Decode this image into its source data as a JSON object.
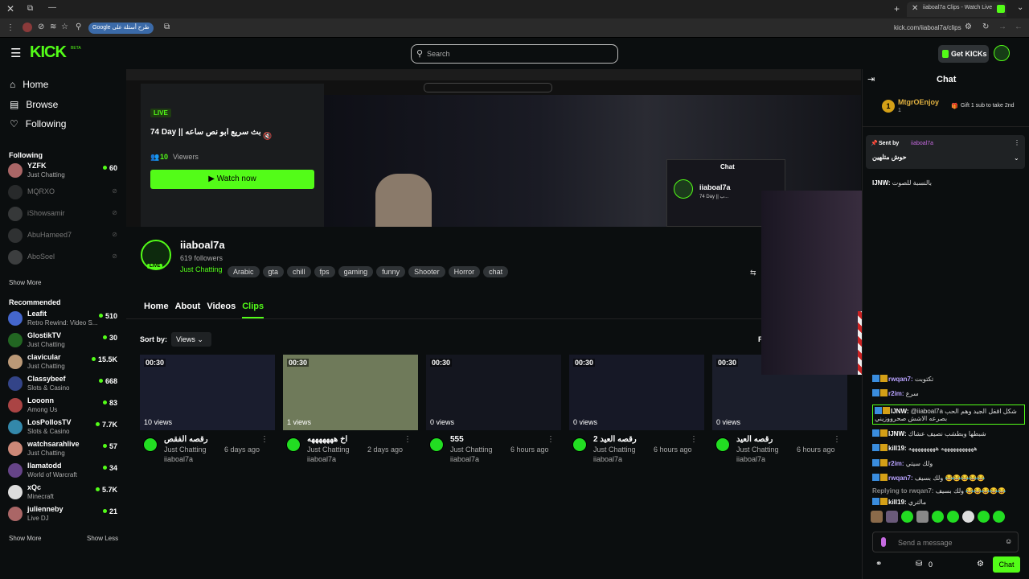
{
  "browser": {
    "tab_title": "iiaboal7a Clips - Watch Live",
    "url": "kick.com/iiaboal7a/clips",
    "search_pill": "Google طرح أسئلة على"
  },
  "header": {
    "logo": "KICK",
    "logo_beta": "BETA",
    "search_placeholder": "Search",
    "get_kicks": "Get KICKs"
  },
  "sidebar": {
    "nav": [
      {
        "label": "Home",
        "icon": "home-icon"
      },
      {
        "label": "Browse",
        "icon": "browse-icon"
      },
      {
        "label": "Following",
        "icon": "heart-icon"
      }
    ],
    "following_title": "Following",
    "following": [
      {
        "name": "YZFK",
        "sub": "Just Chatting",
        "count": "60",
        "live": true,
        "color": "#a66"
      },
      {
        "name": "MQRXO",
        "sub": "",
        "count": "",
        "live": false,
        "color": "#555"
      },
      {
        "name": "iShowsamir",
        "sub": "",
        "count": "",
        "live": false,
        "color": "#777"
      },
      {
        "name": "AbuHameed7",
        "sub": "",
        "count": "",
        "live": false,
        "color": "#666"
      },
      {
        "name": "AboSoel",
        "sub": "",
        "count": "",
        "live": false,
        "color": "#888"
      }
    ],
    "show_more_1": "Show More",
    "recommended_title": "Recommended",
    "recommended": [
      {
        "name": "Leafit",
        "sub": "Retro Rewind: Video S...",
        "count": "510",
        "color": "#46c"
      },
      {
        "name": "GlostikTV",
        "sub": "Just Chatting",
        "count": "30",
        "color": "#262"
      },
      {
        "name": "clavicular",
        "sub": "Just Chatting",
        "count": "15.5K",
        "color": "#b97"
      },
      {
        "name": "Classybeef",
        "sub": "Slots & Casino",
        "count": "668",
        "color": "#348"
      },
      {
        "name": "Looonn",
        "sub": "Among Us",
        "count": "83",
        "color": "#a44"
      },
      {
        "name": "LosPollosTV",
        "sub": "Slots & Casino",
        "count": "7.7K",
        "color": "#38a"
      },
      {
        "name": "watchsarahlive",
        "sub": "Just Chatting",
        "count": "57",
        "color": "#c87"
      },
      {
        "name": "llamatodd",
        "sub": "World of Warcraft",
        "count": "34",
        "color": "#648"
      },
      {
        "name": "xQc",
        "sub": "Minecraft",
        "count": "5.7K",
        "color": "#ddd"
      },
      {
        "name": "julienneby",
        "sub": "Live DJ",
        "count": "21",
        "color": "#a66"
      }
    ],
    "show_more_2": "Show More",
    "show_less": "Show Less"
  },
  "player": {
    "live_badge": "LIVE",
    "stream_title": "74 Day || بث سريع ابو نص ساعه",
    "viewers_count": "10",
    "viewers_label": "Viewers",
    "watch_now": "Watch now",
    "inner_chat": "Chat",
    "inner_channel": "iiaboal7a",
    "inner_title": "74 Day || ب..."
  },
  "channel": {
    "name": "iiaboal7a",
    "followers": "619 followers",
    "category": "Just Chatting",
    "tags": [
      "Arabic",
      "gta",
      "chill",
      "fps",
      "gaming",
      "funny",
      "Shooter",
      "Horror",
      "chat"
    ],
    "live_badge": "LIVE"
  },
  "tabs": [
    "Home",
    "About",
    "Videos",
    "Clips"
  ],
  "active_tab": "Clips",
  "sort": {
    "label": "Sort by:",
    "value": "Views"
  },
  "clips": [
    {
      "duration": "00:30",
      "views": "10 views",
      "title": "رقصه الفقص",
      "category": "Just Chatting",
      "age": "6 days ago",
      "author": "iiaboal7a",
      "bg": "#1a1d2e"
    },
    {
      "duration": "00:30",
      "views": "1 views",
      "title": "اخ هههههههه",
      "category": "Just Chatting",
      "age": "2 days ago",
      "author": "iiaboal7a",
      "bg": "#6f7a5a"
    },
    {
      "duration": "00:30",
      "views": "0 views",
      "title": "555",
      "category": "Just Chatting",
      "age": "6 hours ago",
      "author": "iiaboal7a",
      "bg": "#14161f"
    },
    {
      "duration": "00:30",
      "views": "0 views",
      "title": "رقصه العيد 2",
      "category": "Just Chatting",
      "age": "6 hours ago",
      "author": "iiaboal7a",
      "bg": "#161826"
    },
    {
      "duration": "00:30",
      "views": "0 views",
      "title": "رقصه العيد",
      "category": "Just Chatting",
      "age": "6 hours ago",
      "author": "iiaboal7a",
      "bg": "#1b1e2b"
    }
  ],
  "chat": {
    "title": "Chat",
    "top_gifter": "MtgrOEnjoy",
    "top_gifter_count": "1",
    "gift_text": "Gift 1 sub to take 2nd",
    "pinned_sent_by": "Sent by",
    "pinned_user": "iiaboal7a",
    "pinned_text": "حوش متلهين",
    "messages": [
      {
        "user": "IJNW:",
        "text": "بالنسبة للصوت",
        "color": "#fff"
      },
      {
        "user": "rwqan7:",
        "text": "تكتوبت",
        "color": "#b9a3ff"
      },
      {
        "user": "r2im:",
        "text": "سرع",
        "color": "#b9a3ff"
      },
      {
        "user": "IJNW:",
        "text": "@iiaboal7a شكل اقفل الجيد وهم الحب بصرعه الاشش صحرووزيني",
        "color": "#fff"
      },
      {
        "user": "IJNW:",
        "text": "شبطها وبطشب نصيف عشاك",
        "color": "#fff"
      },
      {
        "user": "kill19:",
        "text": "هههههههههههه هههههههههه",
        "color": "#fff"
      },
      {
        "user": "r2im:",
        "text": "ولك سيتي",
        "color": "#b9a3ff"
      },
      {
        "user": "rwqan7:",
        "text": "ولك بسيف 😂😂😂😂😂",
        "color": "#b9a3ff"
      },
      {
        "user": "Replying to rwqan7:",
        "text": "ولك بسيف 😂😂😂😂😂",
        "color": "#888"
      },
      {
        "user": "kill19:",
        "text": "مالتري",
        "color": "#fff"
      }
    ],
    "send_placeholder": "Send a message",
    "points": "0",
    "chat_button": "Chat"
  }
}
